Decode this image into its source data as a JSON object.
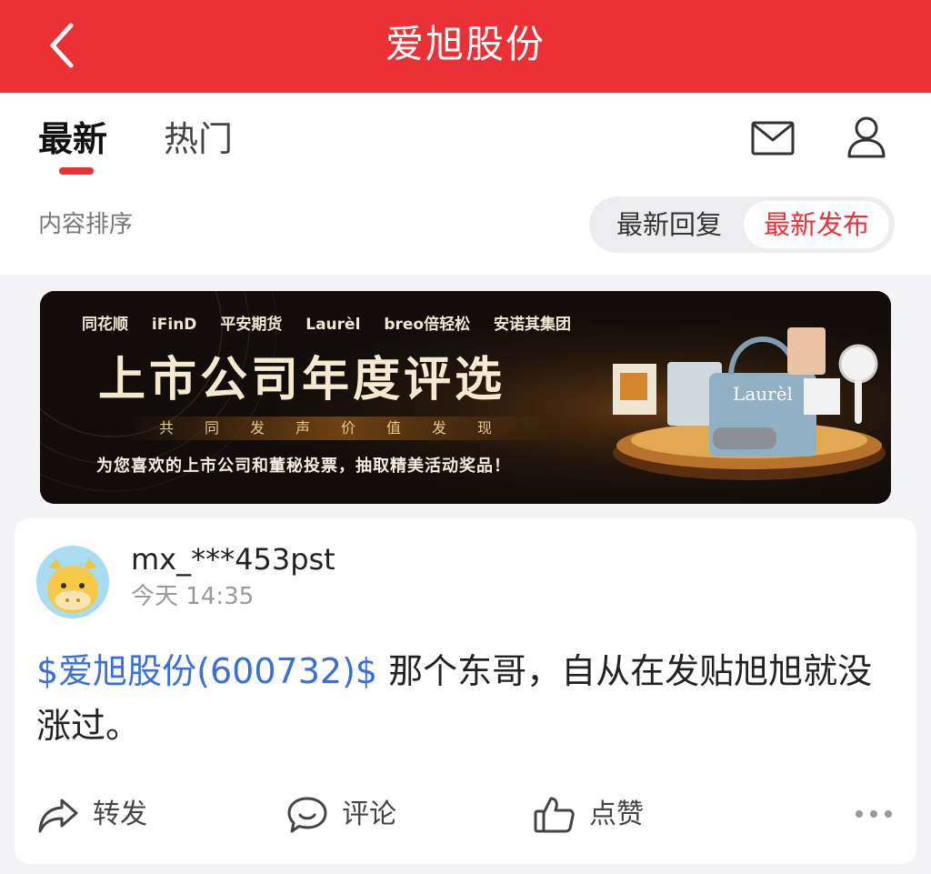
{
  "header": {
    "title": "爱旭股份"
  },
  "tabs": {
    "latest": "最新",
    "hot": "热门"
  },
  "sort": {
    "label": "内容排序",
    "by_reply": "最新回复",
    "by_publish": "最新发布",
    "selected": "最新发布"
  },
  "banner": {
    "partners": [
      "同花顺",
      "iFinD",
      "平安期货",
      "Laurèl",
      "breo倍轻松",
      "安诺其集团"
    ],
    "headline": "上市公司年度评选",
    "subtitle": "共同发声价值发现",
    "description": "为您喜欢的上市公司和董秘投票，抽取精美活动奖品！",
    "product_brand": "Laurèl"
  },
  "post": {
    "username": "mx_***453pst",
    "time": "今天 14:35",
    "stock_tag": "$爱旭股份(600732)$",
    "content": " 那个东哥，自从在发贴旭旭就没涨过。"
  },
  "actions": {
    "share": "转发",
    "comment": "评论",
    "like": "点赞"
  },
  "colors": {
    "accent": "#ea3236",
    "link": "#3a6fd8"
  },
  "icons": [
    "back-icon",
    "mail-icon",
    "user-icon",
    "share-icon",
    "comment-icon",
    "like-icon",
    "more-icon"
  ]
}
